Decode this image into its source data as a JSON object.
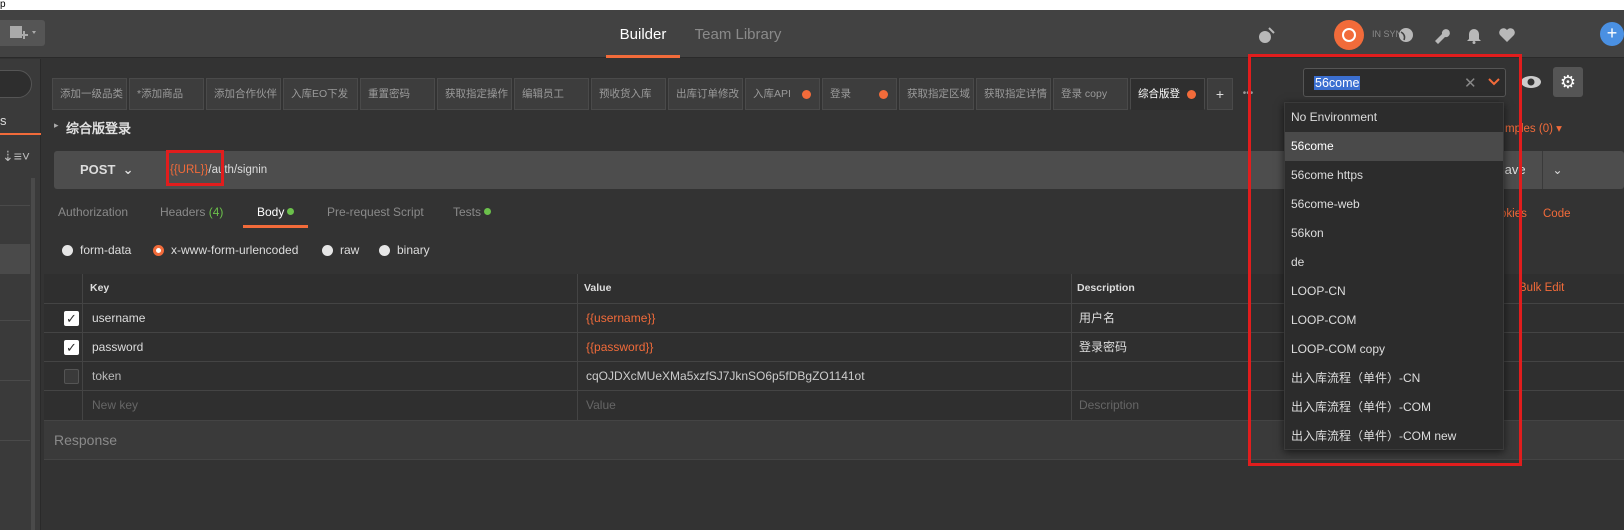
{
  "titlebar": {
    "text": "p"
  },
  "header": {
    "tabs": [
      {
        "label": "Builder",
        "active": true
      },
      {
        "label": "Team Library",
        "active": false
      }
    ],
    "sync_status": "IN SYNC"
  },
  "sidebar": {
    "history_label": "s"
  },
  "request_tabs": [
    {
      "label": "添加一级品类",
      "dot": false
    },
    {
      "label": "*添加商品",
      "dot": false
    },
    {
      "label": "添加合作伙伴",
      "dot": false
    },
    {
      "label": "入库EO下发",
      "dot": false
    },
    {
      "label": "重置密码",
      "dot": false
    },
    {
      "label": "获取指定操作",
      "dot": false
    },
    {
      "label": "编辑员工",
      "dot": false
    },
    {
      "label": "预收货入库",
      "dot": false
    },
    {
      "label": "出库订单修改",
      "dot": false
    },
    {
      "label": "入库API",
      "dot": true
    },
    {
      "label": "登录",
      "dot": true
    },
    {
      "label": "获取指定区域",
      "dot": false
    },
    {
      "label": "获取指定详情",
      "dot": false
    },
    {
      "label": "登录 copy",
      "dot": false
    },
    {
      "label": "综合版登",
      "dot": true,
      "active": true
    }
  ],
  "request_tabs_add": "+",
  "request_tabs_more": "•••",
  "environment": {
    "selected": "56come",
    "clear_glyph": "✕",
    "options": [
      "No Environment",
      "56come",
      "56come https",
      "56come-web",
      "56kon",
      "de",
      "LOOP-CN",
      "LOOP-COM",
      "LOOP-COM copy",
      "出入库流程（单件）-CN",
      "出入库流程（单件）-COM",
      "出入库流程（单件）-COM new"
    ],
    "selected_index": 1
  },
  "request": {
    "title": "综合版登录",
    "examples_link": "mples (0) ▾",
    "method": "POST",
    "url_var": "{{URL}}",
    "url_path": "/auth/signin",
    "save_label": "Save",
    "cookies_link": "okies",
    "code_link": "Code"
  },
  "sub_tabs": [
    {
      "label": "Authorization"
    },
    {
      "label": "Headers",
      "count": "(4)"
    },
    {
      "label": "Body",
      "dot": true,
      "active": true
    },
    {
      "label": "Pre-request Script"
    },
    {
      "label": "Tests",
      "dot": true
    }
  ],
  "body_types": [
    {
      "label": "form-data",
      "selected": false
    },
    {
      "label": "x-www-form-urlencoded",
      "selected": true
    },
    {
      "label": "raw",
      "selected": false
    },
    {
      "label": "binary",
      "selected": false
    }
  ],
  "params": {
    "headers": {
      "key": "Key",
      "value": "Value",
      "description": "Description"
    },
    "bulk_edit": "Bulk Edit",
    "rows": [
      {
        "checked": true,
        "key": "username",
        "value": "{{username}}",
        "description": "用户名"
      },
      {
        "checked": true,
        "key": "password",
        "value": "{{password}}",
        "description": "登录密码"
      },
      {
        "checked": false,
        "key": "token",
        "value": "cqOJDXcMUeXMa5xzfSJ7JknSO6p5fDBgZO1141ot",
        "description": ""
      }
    ],
    "placeholder": {
      "key": "New key",
      "value": "Value",
      "description": "Description"
    }
  },
  "response": {
    "label": "Response"
  },
  "colors": {
    "accent": "#f26b3a",
    "highlight_box": "#e11d1d",
    "green_dot": "#6bc04b"
  }
}
